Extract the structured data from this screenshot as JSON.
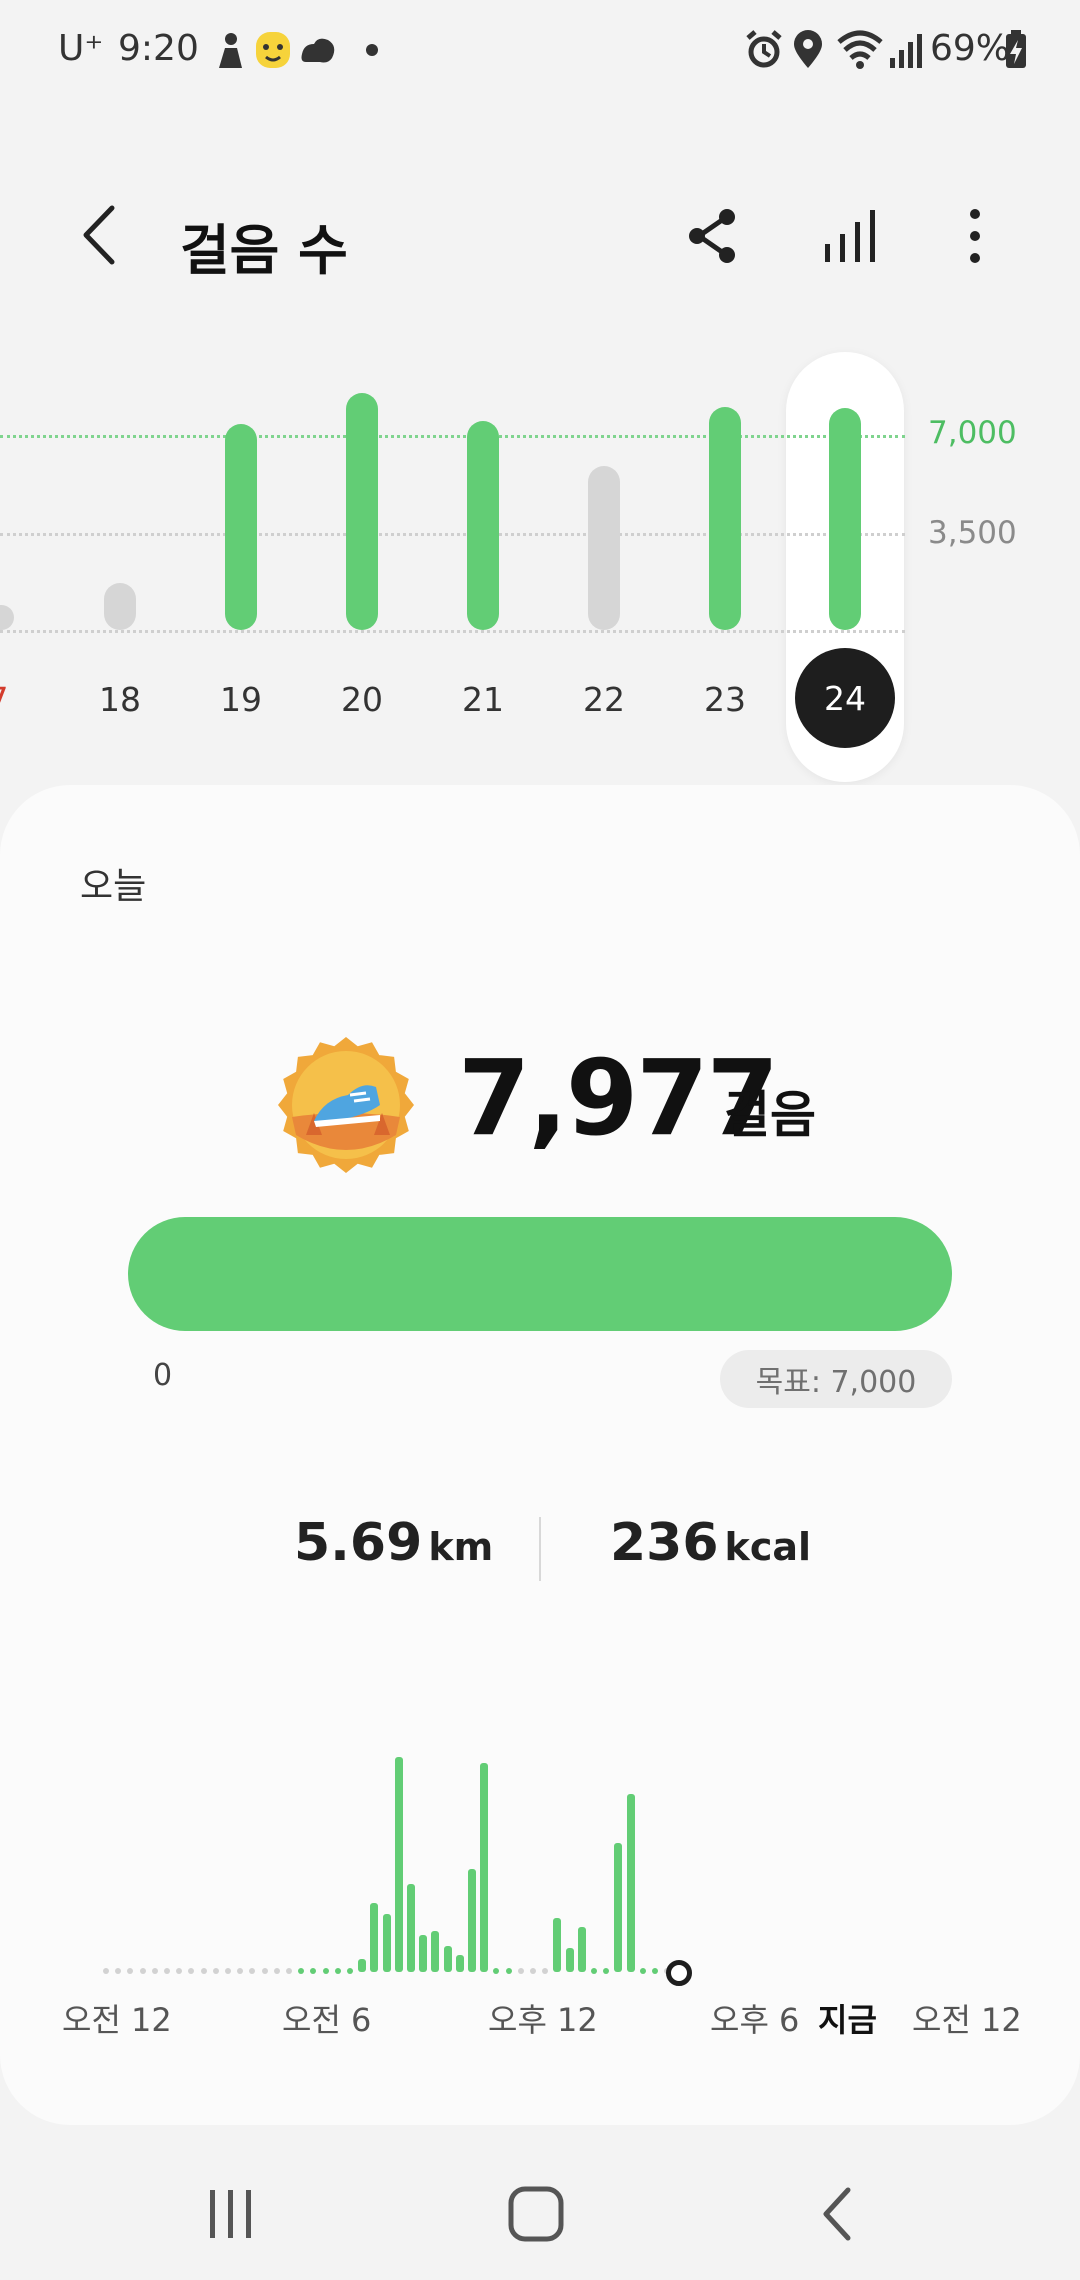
{
  "status_bar": {
    "carrier": "U⁺",
    "time": "9:20",
    "battery_percent": "69%",
    "icons": [
      "person-icon",
      "emoji-icon",
      "cloud-icon",
      "dot-icon",
      "alarm-icon",
      "location-icon",
      "wifi-icon",
      "signal-icon",
      "battery-charging-icon"
    ]
  },
  "header": {
    "title": "걸음 수",
    "icons": [
      "back-icon",
      "share-icon",
      "bar-chart-icon",
      "more-vertical-icon"
    ]
  },
  "weekly_chart": {
    "goal_label": "7,000",
    "half_label": "3,500",
    "days": [
      {
        "label": "7",
        "value": 900,
        "met": false,
        "weekend": true,
        "partial": true
      },
      {
        "label": "18",
        "value": 1700,
        "met": false
      },
      {
        "label": "19",
        "value": 7400,
        "met": true
      },
      {
        "label": "20",
        "value": 8500,
        "met": true
      },
      {
        "label": "21",
        "value": 7500,
        "met": true
      },
      {
        "label": "22",
        "value": 5900,
        "met": false
      },
      {
        "label": "23",
        "value": 8000,
        "met": true
      },
      {
        "label": "24",
        "value": 7977,
        "met": true,
        "selected": true
      }
    ],
    "colors": {
      "met": "#62cd75",
      "unmet": "#d6d6d6",
      "weekend": "#d33b2c",
      "selected": "#1e1e1e"
    }
  },
  "today": {
    "label": "오늘",
    "steps": "7,977",
    "steps_unit": "걸음",
    "badge_icon": "sneaker-badge-icon",
    "progress_start": "0",
    "goal_text": "목표: 7,000",
    "progress_fraction": 1.0,
    "distance": "5.69",
    "distance_unit": "km",
    "calories": "236",
    "calories_unit": "kcal"
  },
  "hourly_chart": {
    "x_labels": [
      "오전 12",
      "오전 6",
      "오후 12",
      "오후 6",
      "지금",
      "오전 12"
    ],
    "bar_values": [
      0,
      0,
      0,
      0,
      0,
      0,
      0,
      0,
      0,
      0,
      0,
      0,
      0,
      0,
      0,
      0,
      0.05,
      0.05,
      0.05,
      0.05,
      0.05,
      0.06,
      0.32,
      0.27,
      1.0,
      0.41,
      0.17,
      0.19,
      0.12,
      0.08,
      0.48,
      0.97,
      0.04,
      0.04,
      0,
      0,
      0,
      0.25,
      0.11,
      0.21,
      0.03,
      0.03,
      0.6,
      0.83,
      0.04,
      0.04
    ],
    "colors": {
      "bar": "#62cd75",
      "idle_dot": "#d2d2d2",
      "now": "#1e1e1e"
    }
  },
  "nav_bar": {
    "icons": [
      "recent-apps-icon",
      "home-icon",
      "nav-back-icon"
    ]
  }
}
